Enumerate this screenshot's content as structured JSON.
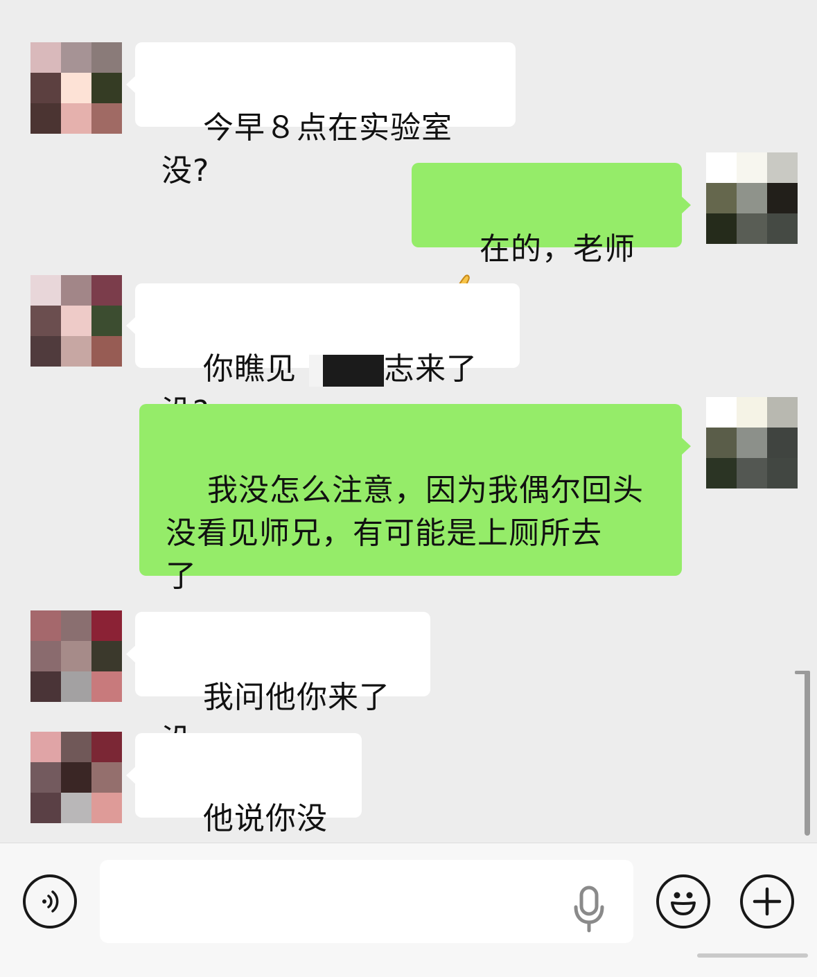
{
  "messages": [
    {
      "direction": "incoming",
      "text": "今早８点在实验室没?",
      "avatar_colors": [
        "#d9b9bb",
        "#a69395",
        "#8a7b79",
        "#5c4040",
        "#fde2d6",
        "#353c24",
        "#4b3432",
        "#e5b1ad",
        "#a06a64"
      ]
    },
    {
      "direction": "outgoing",
      "text": "在的，老师",
      "emoji": "ok-hand-emoji",
      "avatar_colors": [
        "#ffffff",
        "#f7f6ef",
        "#c9c9c3",
        "#65674d",
        "#8f938b",
        "#221f1a",
        "#252b1b",
        "#595d55",
        "#454a44"
      ]
    },
    {
      "direction": "incoming",
      "text_before": "你瞧见",
      "text_after": "志来了没?",
      "avatar_colors": [
        "#e8d6d9",
        "#a28688",
        "#7b3d4b",
        "#6b4e4f",
        "#eecbc8",
        "#3c4d30",
        "#503b3d",
        "#c7a7a3",
        "#975c54"
      ]
    },
    {
      "direction": "outgoing",
      "text": "我没怎么注意，因为我偶尔回头\n没看见师兄，有可能是上厕所去\n了",
      "avatar_colors": [
        "#ffffff",
        "#f5f3e6",
        "#b8b8b0",
        "#5a5d49",
        "#8c908a",
        "#404440",
        "#2b3424",
        "#535752",
        "#424742"
      ]
    },
    {
      "direction": "incoming",
      "text": "我问他你来了没",
      "avatar_colors": [
        "#a5686c",
        "#8a6f70",
        "#8b2235",
        "#8a6b6e",
        "#a68b89",
        "#3b392c",
        "#4a3437",
        "#a3a1a2",
        "#c87a7c"
      ]
    },
    {
      "direction": "incoming",
      "text": "他说你没来",
      "avatar_colors": [
        "#e0a4a6",
        "#705858",
        "#7b2735",
        "#735a5e",
        "#3a2625",
        "#946f6d",
        "#5a4045",
        "#b9b7b8",
        "#de9b98"
      ]
    }
  ],
  "input": {
    "placeholder": "",
    "value": ""
  },
  "icons": {
    "voice": "voice-toggle-icon",
    "mic": "microphone-icon",
    "emoji": "emoji-icon",
    "plus": "plus-icon"
  }
}
